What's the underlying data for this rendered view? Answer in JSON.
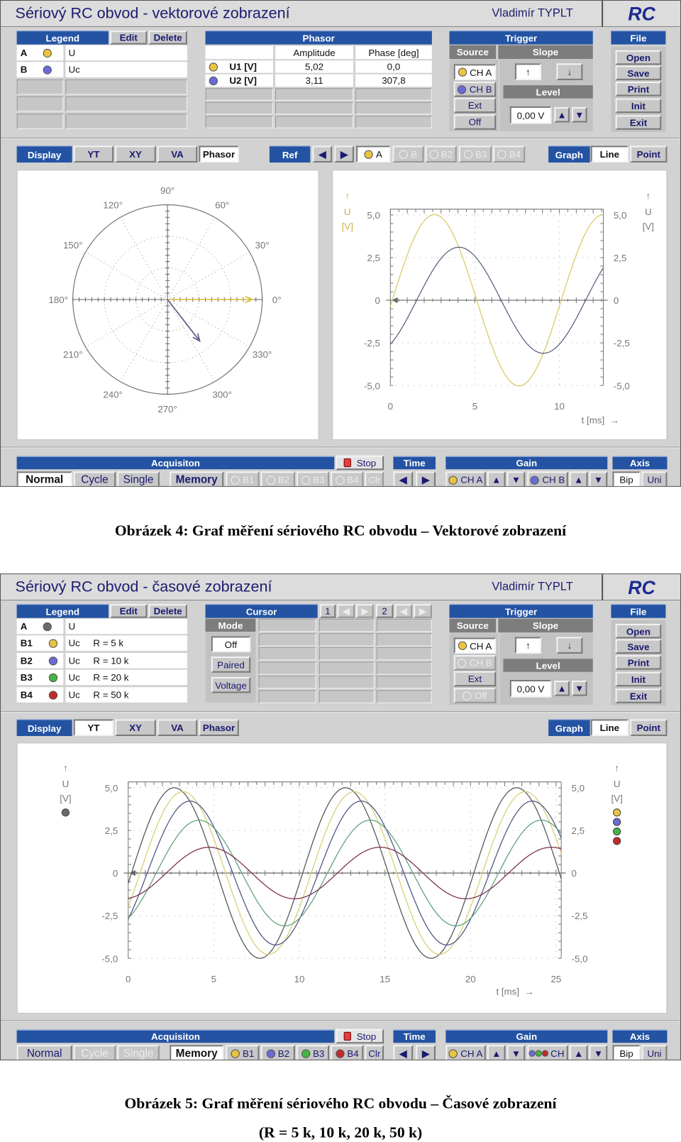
{
  "figures": [
    {
      "window": {
        "title": "Sériový RC obvod - vektorové zobrazení",
        "author": "Vladimír TYPLT",
        "logo": "RC",
        "legend": {
          "header": "Legend",
          "edit": "Edit",
          "delete": "Delete",
          "rows": [
            {
              "id": "A",
              "color": "#e8c440",
              "label": "U"
            },
            {
              "id": "B",
              "color": "#6b6bd6",
              "label": "Uc"
            }
          ]
        },
        "phasor": {
          "header": "Phasor",
          "col_amplitude": "Amplitude",
          "col_phase": "Phase [deg]",
          "rows": [
            {
              "color": "#e8c440",
              "name": "U1 [V]",
              "amplitude": "5,02",
              "phase": "0,0"
            },
            {
              "color": "#6b6bd6",
              "name": "U2 [V]",
              "amplitude": "3,11",
              "phase": "307,8"
            }
          ]
        },
        "trigger": {
          "header": "Trigger",
          "source": "Source",
          "slope": "Slope",
          "sources": [
            {
              "label": "CH A",
              "color": "#e8c440",
              "state": "selected"
            },
            {
              "label": "CH B",
              "color": "#6b6bd6",
              "state": "normal"
            },
            {
              "label": "Ext",
              "state": "normal"
            },
            {
              "label": "Off",
              "state": "normal"
            }
          ],
          "slope_up": "↑",
          "slope_down": "↓",
          "slope_selected": "up",
          "level": "Level",
          "level_value": "0,00 V"
        },
        "file": {
          "header": "File",
          "buttons": [
            "Open",
            "Save",
            "Print",
            "Init",
            "Exit"
          ]
        },
        "toolbar": {
          "display": "Display",
          "modes": [
            "YT",
            "XY",
            "VA",
            "Phasor"
          ],
          "selected_mode": "Phasor",
          "ref": {
            "label": "Ref",
            "channels": [
              {
                "label": "A",
                "color": "#e8c440",
                "state": "selected"
              },
              {
                "label": "B",
                "state": "disabled"
              },
              {
                "label": "B2",
                "state": "disabled"
              },
              {
                "label": "B3",
                "state": "disabled"
              },
              {
                "label": "B4",
                "state": "disabled"
              }
            ]
          },
          "graph": "Graph",
          "styles": [
            "Line",
            "Point"
          ],
          "selected_style": "Line"
        },
        "bottom": {
          "acquisition": "Acquisiton",
          "stop": "Stop",
          "modes": [
            {
              "label": "Normal",
              "state": "selected"
            },
            {
              "label": "Cycle",
              "state": "normal"
            },
            {
              "label": "Single",
              "state": "normal"
            }
          ],
          "memory": {
            "label": "Memory",
            "state": "normal"
          },
          "memory_slots": [
            {
              "label": "B1",
              "state": "disabled"
            },
            {
              "label": "B2",
              "state": "disabled"
            },
            {
              "label": "B3",
              "state": "disabled"
            },
            {
              "label": "B4",
              "state": "disabled"
            }
          ],
          "clear": {
            "label": "Clr",
            "state": "disabled"
          },
          "time": "Time",
          "gain": "Gain",
          "gain_channels": [
            {
              "label": "CH A",
              "colors": [
                "#e8c440"
              ]
            },
            {
              "label": "CH B",
              "colors": [
                "#6b6bd6"
              ]
            }
          ],
          "axis": "Axis",
          "axis_modes": [
            "Bip",
            "Uni"
          ],
          "selected_axis": "Bip"
        }
      },
      "caption": [
        "Obrázek 4: Graf měření sériového RC obvodu – Vektorové zobrazení"
      ]
    },
    {
      "window": {
        "title": "Sériový RC obvod - časové zobrazení",
        "author": "Vladimír TYPLT",
        "logo": "RC",
        "legend": {
          "header": "Legend",
          "edit": "Edit",
          "delete": "Delete",
          "rows": [
            {
              "id": "A",
              "color": "#6a6a6a",
              "label": "U"
            },
            {
              "id": "B1",
              "color": "#e8c440",
              "label": "Uc     R = 5 k"
            },
            {
              "id": "B2",
              "color": "#6b6bd6",
              "label": "Uc     R = 10 k"
            },
            {
              "id": "B3",
              "color": "#44b444",
              "label": "Uc     R = 20 k"
            },
            {
              "id": "B4",
              "color": "#c42a2a",
              "label": "Uc     R = 50 k"
            }
          ]
        },
        "cursor": {
          "header": "Cursor",
          "c1": "1",
          "c2": "2",
          "mode": "Mode",
          "modes": [
            "Off",
            "Paired",
            "Voltage"
          ],
          "selected_mode": "Off"
        },
        "trigger": {
          "header": "Trigger",
          "source": "Source",
          "slope": "Slope",
          "sources": [
            {
              "label": "CH A",
              "color": "#e8c440",
              "state": "selected"
            },
            {
              "label": "CH B",
              "state": "disabled"
            },
            {
              "label": "Ext",
              "state": "normal"
            },
            {
              "label": "Off",
              "state": "disabled"
            }
          ],
          "slope_up": "↑",
          "slope_down": "↓",
          "slope_selected": "up",
          "level": "Level",
          "level_value": "0,00 V"
        },
        "file": {
          "header": "File",
          "buttons": [
            "Open",
            "Save",
            "Print",
            "Init",
            "Exit"
          ]
        },
        "toolbar": {
          "display": "Display",
          "modes": [
            "YT",
            "XY",
            "VA",
            "Phasor"
          ],
          "selected_mode": "YT",
          "graph": "Graph",
          "styles": [
            "Line",
            "Point"
          ],
          "selected_style": "Line"
        },
        "bottom": {
          "acquisition": "Acquisiton",
          "stop": "Stop",
          "modes": [
            {
              "label": "Normal",
              "state": "normal"
            },
            {
              "label": "Cycle",
              "state": "disabled"
            },
            {
              "label": "Single",
              "state": "disabled"
            }
          ],
          "memory": {
            "label": "Memory",
            "state": "selected"
          },
          "memory_slots": [
            {
              "label": "B1",
              "color": "#e8c440",
              "state": "normal"
            },
            {
              "label": "B2",
              "color": "#6b6bd6",
              "state": "normal"
            },
            {
              "label": "B3",
              "color": "#44b444",
              "state": "normal"
            },
            {
              "label": "B4",
              "color": "#c42a2a",
              "state": "normal"
            }
          ],
          "clear": {
            "label": "Clr",
            "state": "normal"
          },
          "time": "Time",
          "gain": "Gain",
          "gain_channels": [
            {
              "label": "CH A",
              "colors": [
                "#e8c440"
              ]
            },
            {
              "label": "CH B",
              "colors": [
                "#e8c440",
                "#6b6bd6",
                "#44b444",
                "#c42a2a"
              ]
            }
          ],
          "axis": "Axis",
          "axis_modes": [
            "Bip",
            "Uni"
          ],
          "selected_axis": "Bip"
        }
      },
      "caption": [
        "Obrázek 5: Graf měření sériového RC obvodu – Časové zobrazení",
        "(R = 5 k, 10 k, 20 k, 50 k)"
      ]
    }
  ],
  "chart_data": [
    {
      "type": "polar-phasor",
      "angle_ticks": [
        {
          "angle": 0,
          "label": "0°"
        },
        {
          "angle": 30,
          "label": "30°"
        },
        {
          "angle": 60,
          "label": "60°"
        },
        {
          "angle": 90,
          "label": "90°"
        },
        {
          "angle": 120,
          "label": "120°"
        },
        {
          "angle": 150,
          "label": "150°"
        },
        {
          "angle": 180,
          "label": "180°"
        },
        {
          "angle": 210,
          "label": "210°"
        },
        {
          "angle": 240,
          "label": "240°"
        },
        {
          "angle": 270,
          "label": "270°"
        },
        {
          "angle": 300,
          "label": "300°"
        },
        {
          "angle": 330,
          "label": "330°"
        }
      ],
      "grid": true,
      "series": [
        {
          "amplitude": 5.02,
          "phase_deg": 0.0,
          "color": "#d8c040"
        },
        {
          "amplitude": 3.11,
          "phase_deg": 307.8,
          "color": "#5a5a8a"
        }
      ]
    },
    {
      "type": "line",
      "xlabel": "t [ms]",
      "ylabel_symbol": "U",
      "ylabel_unit": "[V]",
      "xlim": [
        0,
        12.6
      ],
      "ylim": [
        -5,
        5
      ],
      "grid": true,
      "xticks": [
        {
          "value": 0,
          "label": "0"
        },
        {
          "value": 5,
          "label": "5"
        },
        {
          "value": 10,
          "label": "10"
        }
      ],
      "yticks": [
        {
          "value": 5,
          "label": "5,0"
        },
        {
          "value": 2.5,
          "label": "2,5"
        },
        {
          "value": 0,
          "label": "0"
        },
        {
          "value": -2.5,
          "label": "-2,5"
        },
        {
          "value": -5,
          "label": "-5,0"
        }
      ],
      "series": [
        {
          "shape": "sine",
          "amplitude": 5.02,
          "period_ms": 10,
          "phase_deg_at_t0": -4,
          "color": "#d8c860"
        },
        {
          "shape": "sine",
          "amplitude": 3.11,
          "period_ms": 10,
          "phase_deg_at_t0": -56,
          "color": "#5a5a7a"
        }
      ]
    },
    {
      "type": "line",
      "xlabel": "t [ms]",
      "ylabel_symbol": "U",
      "ylabel_unit": "[V]",
      "xlim": [
        0,
        25.3
      ],
      "ylim": [
        -5,
        5
      ],
      "grid": true,
      "xticks": [
        {
          "value": 0,
          "label": "0"
        },
        {
          "value": 5,
          "label": "5"
        },
        {
          "value": 10,
          "label": "10"
        },
        {
          "value": 15,
          "label": "15"
        },
        {
          "value": 20,
          "label": "20"
        },
        {
          "value": 25,
          "label": "25"
        }
      ],
      "yticks": [
        {
          "value": 5,
          "label": "5,0"
        },
        {
          "value": 2.5,
          "label": "2,5"
        },
        {
          "value": 0,
          "label": "0"
        },
        {
          "value": -2.5,
          "label": "-2,5"
        },
        {
          "value": -5,
          "label": "-5,0"
        }
      ],
      "legend_dots_left": [
        "#6a6a6a"
      ],
      "legend_dots_right": [
        "#e8c440",
        "#6b6bd6",
        "#44b444",
        "#c42a2a"
      ],
      "series": [
        {
          "shape": "sine",
          "amplitude": 5.0,
          "period_ms": 10,
          "phase_deg_at_t0": -7,
          "color": "#505050"
        },
        {
          "shape": "sine",
          "amplitude": 4.77,
          "period_ms": 10,
          "phase_deg_at_t0": -25,
          "color": "#d8cc70"
        },
        {
          "shape": "sine",
          "amplitude": 4.22,
          "period_ms": 10,
          "phase_deg_at_t0": -40,
          "color": "#4a5080"
        },
        {
          "shape": "sine",
          "amplitude": 3.1,
          "period_ms": 10,
          "phase_deg_at_t0": -59,
          "color": "#58a078"
        },
        {
          "shape": "sine",
          "amplitude": 1.51,
          "period_ms": 10,
          "phase_deg_at_t0": -80,
          "color": "#7a2a4a"
        }
      ]
    }
  ]
}
